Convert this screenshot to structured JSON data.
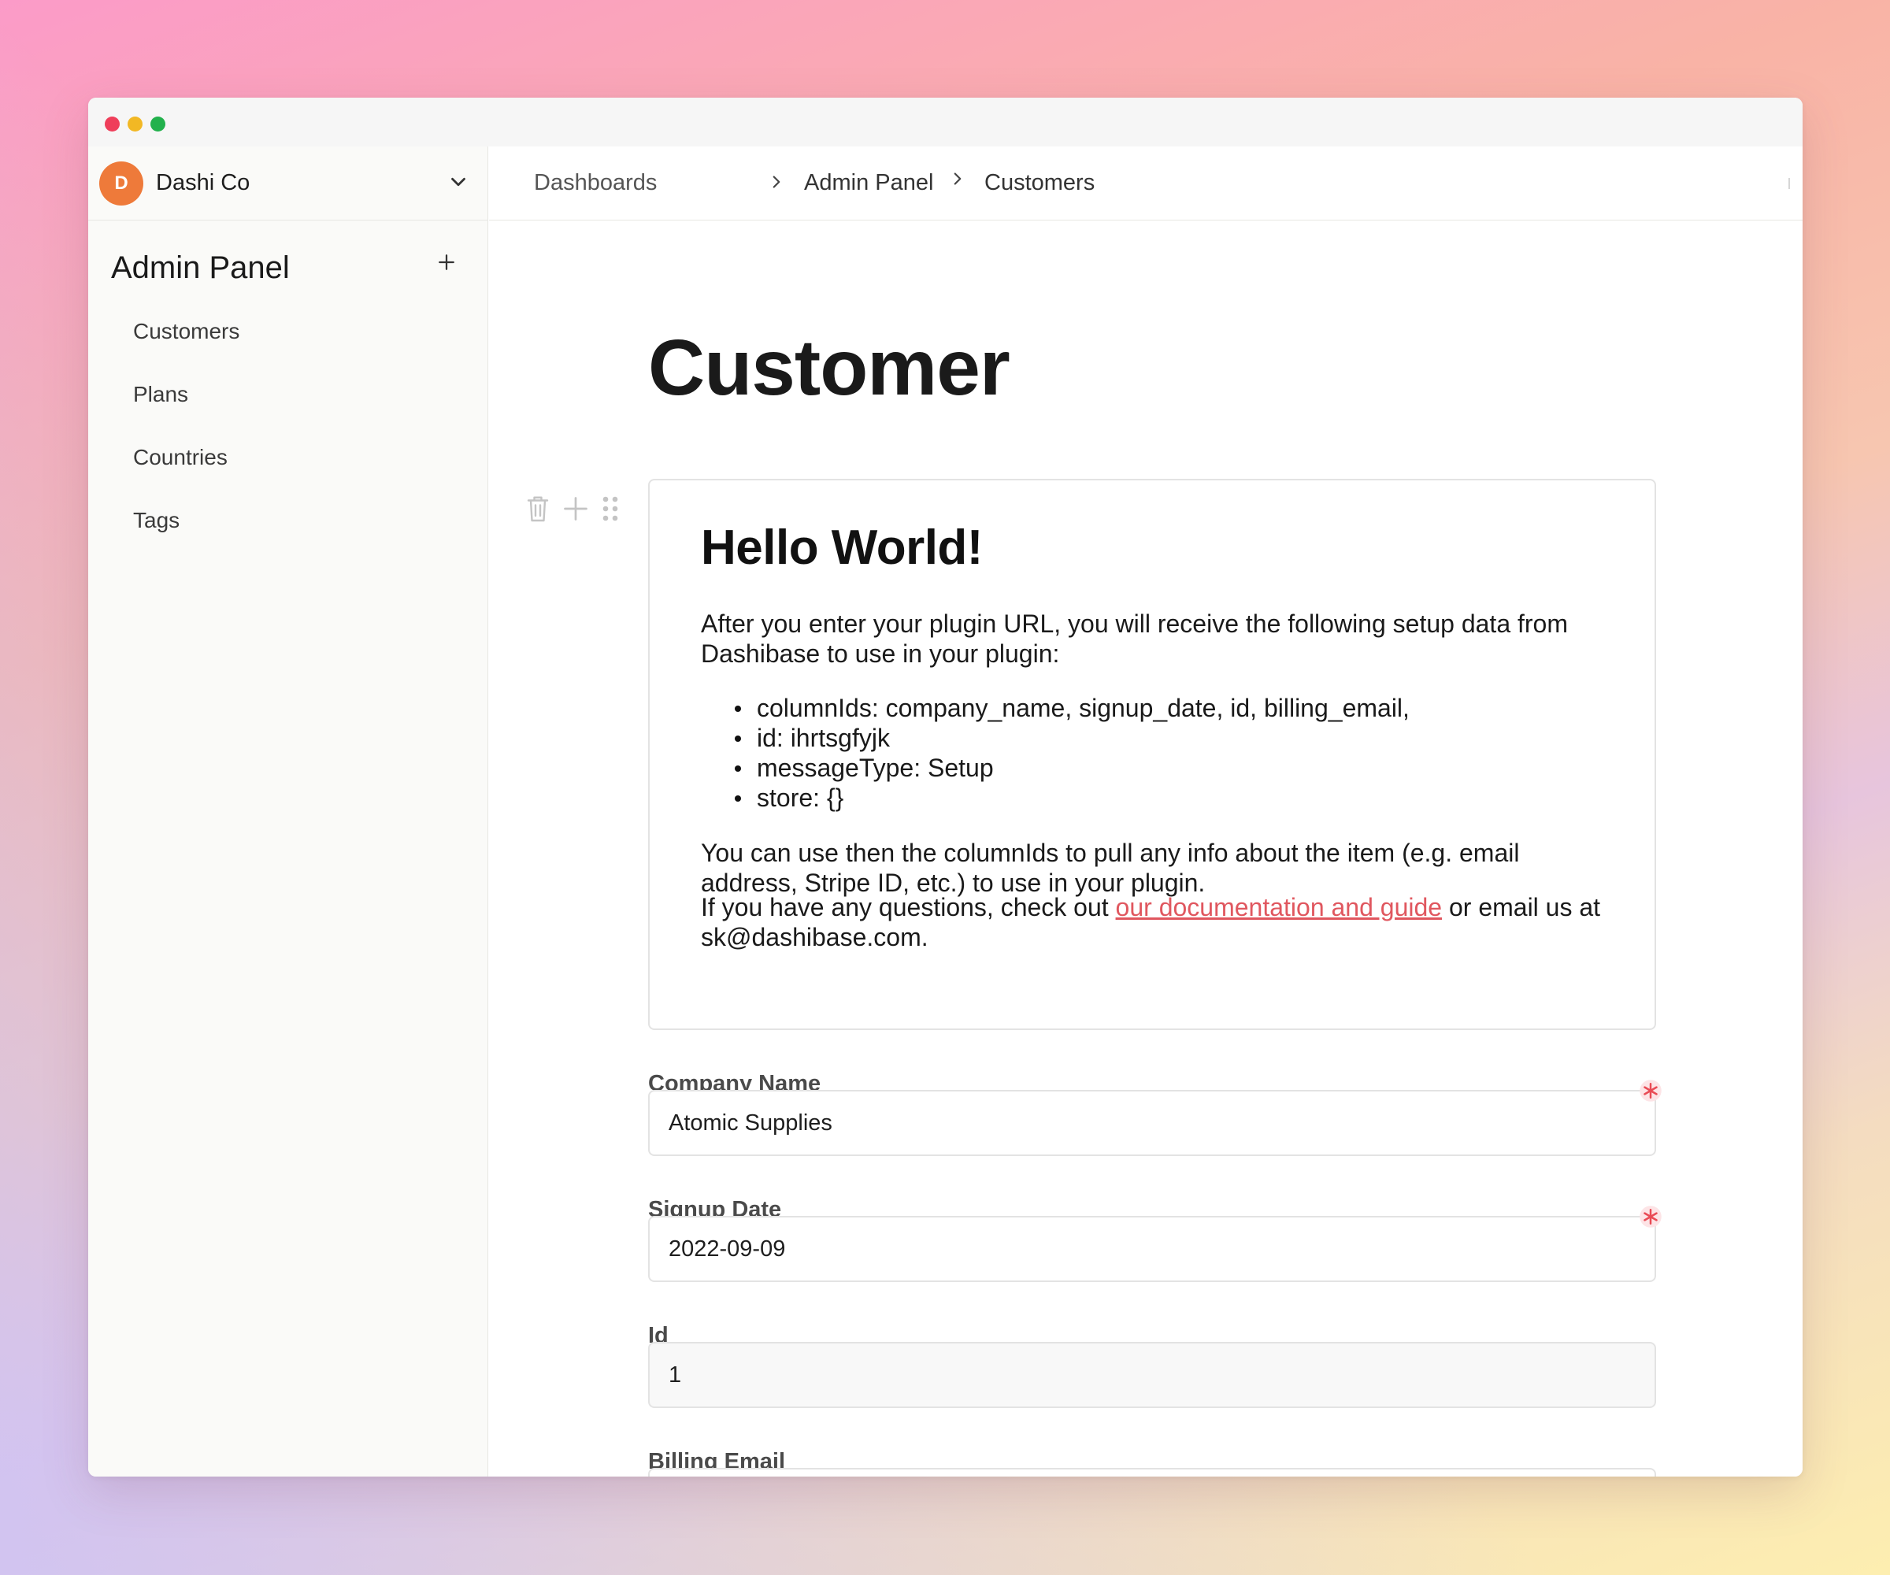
{
  "workspace": {
    "initial": "D",
    "name": "Dashi Co"
  },
  "sidebar": {
    "title": "Admin Panel",
    "items": [
      {
        "label": "Customers"
      },
      {
        "label": "Plans"
      },
      {
        "label": "Countries"
      },
      {
        "label": "Tags"
      }
    ]
  },
  "breadcrumb": [
    "Dashboards",
    "Admin Panel",
    "Customers"
  ],
  "page": {
    "title": "Customer"
  },
  "card": {
    "heading": "Hello World!",
    "intro": "After you enter your plugin URL, you will receive the following setup data from Dashibase to use in your plugin:",
    "list": [
      "columnIds: company_name, signup_date, id, billing_email,",
      "id: ihrtsgfyjk",
      "messageType: Setup",
      "store: {}"
    ],
    "para2": "You can use then the columnIds to pull any info about the item (e.g. email address, Stripe ID, etc.) to use in your plugin.",
    "para3_before": "If you have any questions, check out ",
    "para3_link": "our documentation and guide",
    "para3_after": " or email us at sk@dashibase.com."
  },
  "fields": [
    {
      "label": "Company Name",
      "value": "Atomic Supplies",
      "required": true
    },
    {
      "label": "Signup Date",
      "value": "2022-09-09",
      "required": true
    },
    {
      "label": "Id",
      "value": "1",
      "required": false
    },
    {
      "label": "Billing Email",
      "value": "",
      "required": false
    }
  ],
  "colors": {
    "accent": "#e0575f",
    "avatar": "#ee7a3a",
    "required": "#e94b55"
  }
}
